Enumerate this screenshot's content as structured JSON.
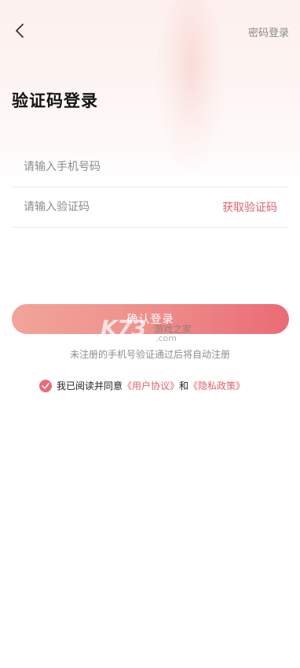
{
  "header": {
    "back_icon": "chevron-left-icon",
    "password_login": "密码登录"
  },
  "title": "验证码登录",
  "form": {
    "phone_placeholder": "请输入手机号码",
    "code_placeholder": "请输入验证码",
    "get_code": "获取验证码"
  },
  "confirm_button": "确认登录",
  "hint": "未注册的手机号验证通过后将自动注册",
  "agreement": {
    "prefix": "我已阅读并同意",
    "user_agreement": "《用户协议》",
    "and": "和",
    "privacy_policy": "《隐私政策》",
    "checked": true
  },
  "watermark": {
    "logo": "K73",
    "text": "游戏之家",
    "domain": ".com"
  },
  "colors": {
    "accent": "#e2616b",
    "button_start": "#f2a49a",
    "button_end": "#ea6b74"
  }
}
